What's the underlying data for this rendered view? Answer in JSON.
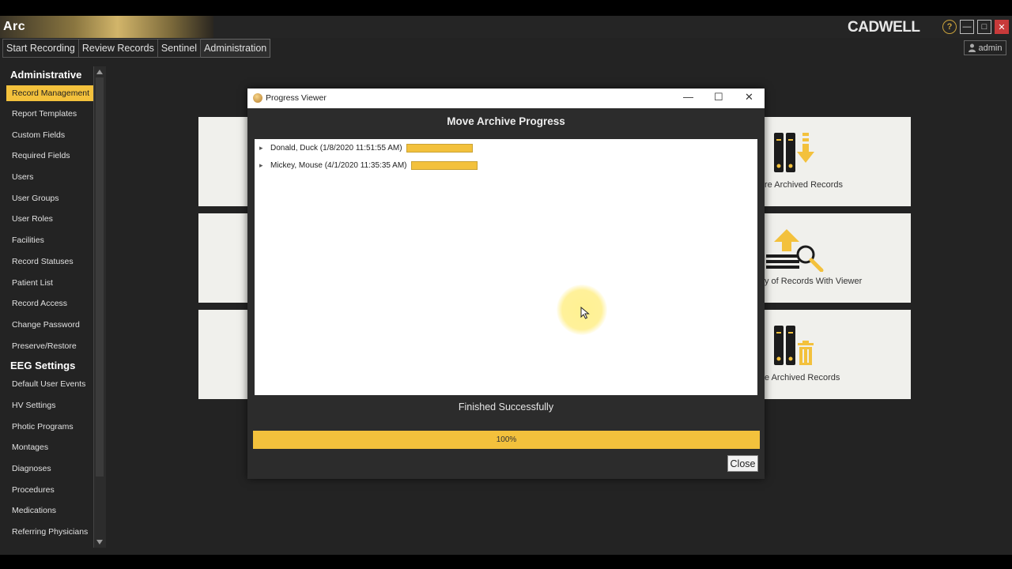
{
  "app": {
    "logo_text": "Arc",
    "brand": "CADWELL",
    "user": "admin"
  },
  "tabs": [
    {
      "label": "Start Recording"
    },
    {
      "label": "Review Records"
    },
    {
      "label": "Sentinel"
    },
    {
      "label": "Administration"
    }
  ],
  "sidebar": {
    "administrative_header": "Administrative",
    "administrative_items": [
      {
        "label": "Record Management"
      },
      {
        "label": "Report Templates"
      },
      {
        "label": "Custom Fields"
      },
      {
        "label": "Required Fields"
      },
      {
        "label": "Users"
      },
      {
        "label": "User Groups"
      },
      {
        "label": "User Roles"
      },
      {
        "label": "Facilities"
      },
      {
        "label": "Record Statuses"
      },
      {
        "label": "Patient List"
      },
      {
        "label": "Record Access"
      },
      {
        "label": "Change Password"
      },
      {
        "label": "Preserve/Restore"
      }
    ],
    "eeg_header": "EEG Settings",
    "eeg_items": [
      {
        "label": "Default User Events"
      },
      {
        "label": "HV Settings"
      },
      {
        "label": "Photic Programs"
      },
      {
        "label": "Montages"
      },
      {
        "label": "Diagnoses"
      },
      {
        "label": "Procedures"
      },
      {
        "label": "Medications"
      },
      {
        "label": "Referring Physicians"
      }
    ]
  },
  "cards": [
    {
      "label": "re Archived Records"
    },
    {
      "label": "y of Records With Viewer"
    },
    {
      "label": "e Archived Records"
    }
  ],
  "dialog": {
    "title": "Progress Viewer",
    "heading": "Move Archive Progress",
    "rows": [
      {
        "label": "Donald, Duck (1/8/2020 11:51:55 AM)",
        "progress": 1.0
      },
      {
        "label": "Mickey, Mouse (4/1/2020 11:35:35 AM)",
        "progress": 1.0
      }
    ],
    "status": "Finished Successfully",
    "progress_label": "100%",
    "progress_value": 100,
    "close_label": "Close"
  },
  "colors": {
    "accent": "#f3c13c",
    "close_red": "#c83a3a"
  }
}
